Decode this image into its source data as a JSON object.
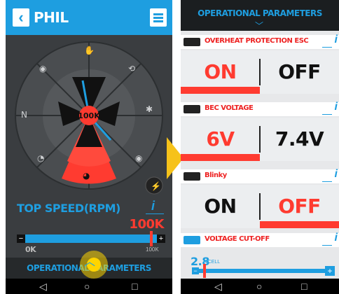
{
  "left": {
    "title": "PHIL",
    "dial_center_value": "100K",
    "param_label": "TOP SPEED(RPM)",
    "info": "i",
    "value": "100K",
    "slider": {
      "min_label": "0K",
      "max_label": "100K",
      "minus": "−",
      "plus": "+",
      "position": 0.91
    },
    "bottom_label": "OPERATIONAL PARAMETERS",
    "nav": {
      "back": "◁",
      "home": "○",
      "recent": "□"
    }
  },
  "right": {
    "header": "OPERATIONAL PARAMETERS",
    "sections": [
      {
        "title": "OVERHEAT PROTECTION ESC",
        "options": [
          "ON",
          "OFF"
        ],
        "selected": 0
      },
      {
        "title": "BEC VOLTAGE",
        "options": [
          "6V",
          "7.4V"
        ],
        "selected": 0
      },
      {
        "title": "Blinky",
        "options": [
          "ON",
          "OFF"
        ],
        "selected": 1
      }
    ],
    "voltage": {
      "title": "VOLTAGE CUT-OFF",
      "value": "2.8",
      "unit": "VCELL",
      "minus": "−",
      "plus": "+",
      "position": 0.08
    },
    "info": "i",
    "nav": {
      "back": "◁",
      "home": "○",
      "recent": "□"
    }
  },
  "colors": {
    "accent": "#1e9ee0",
    "active": "#ff3b30",
    "highlight": "#ffd400"
  }
}
